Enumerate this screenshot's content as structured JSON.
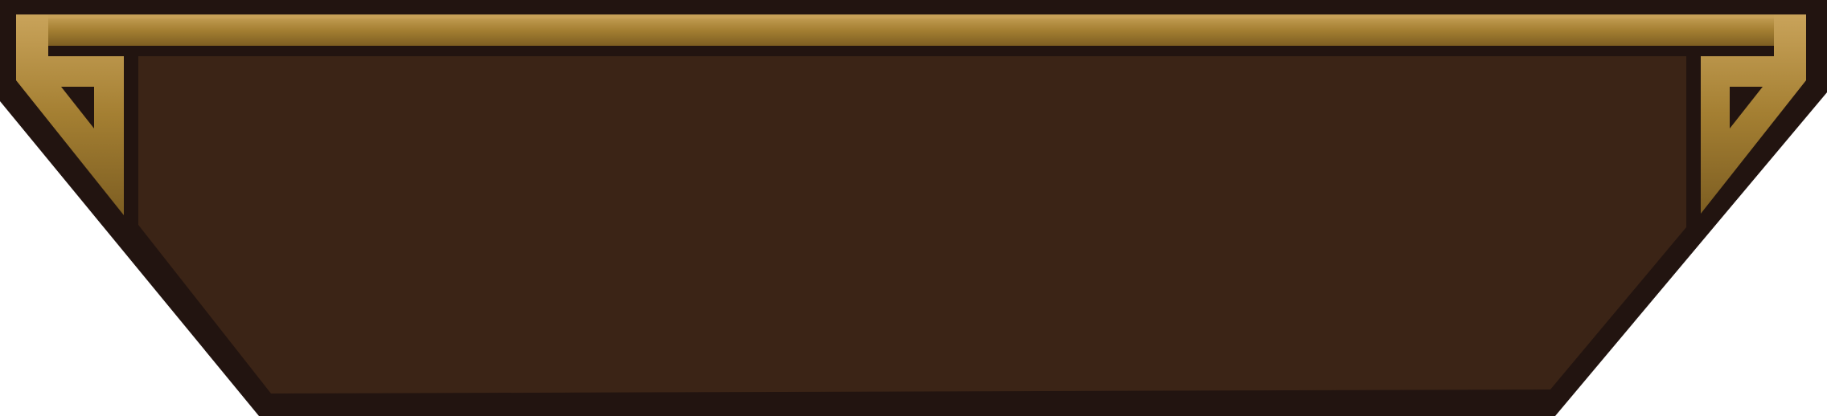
{
  "banner": {
    "colors": {
      "background": "#ffffff",
      "outer_frame": "#221410",
      "inner_panel": "#3b2416",
      "gold_trim": "#a47f32",
      "gold_highlight": "#c9a35a",
      "gold_shadow": "#7d5e22"
    },
    "ornaments": {
      "left": "gold-corner-bracket-icon",
      "right": "gold-corner-bracket-icon"
    }
  }
}
